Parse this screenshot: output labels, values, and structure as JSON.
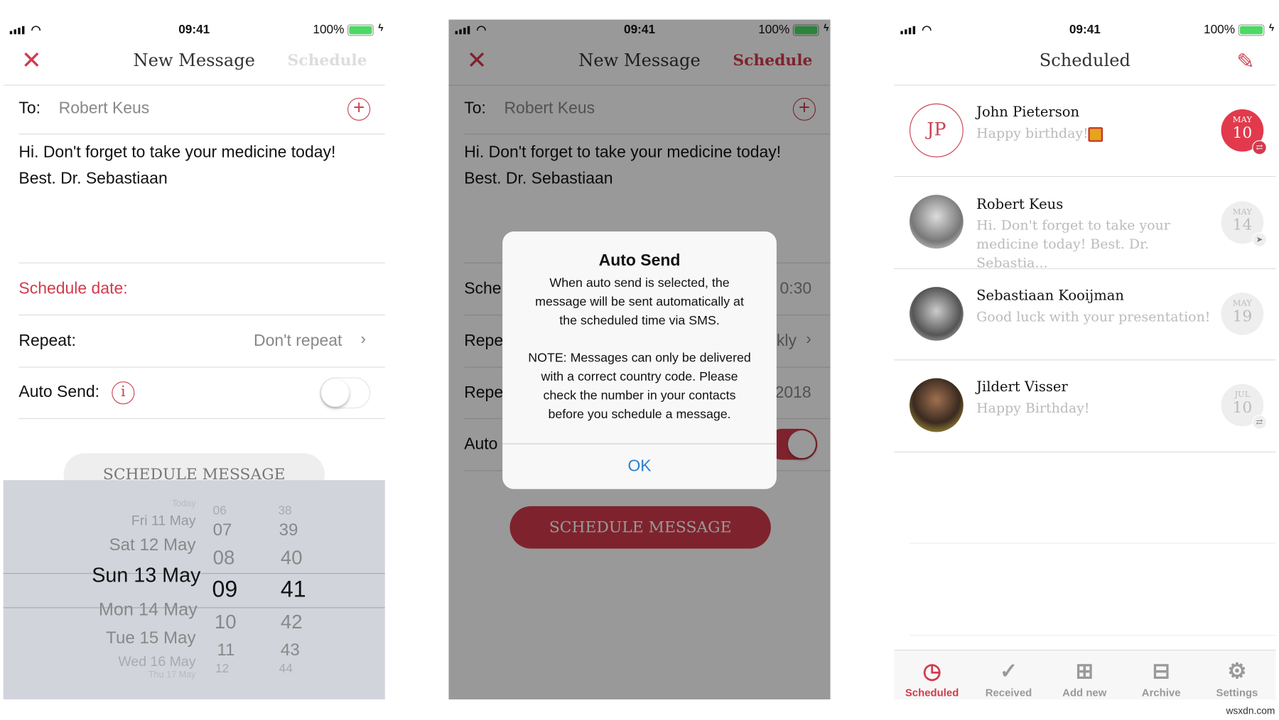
{
  "status": {
    "time": "09:41",
    "battery": "100%"
  },
  "colors": {
    "accent": "#d23b4c",
    "badge": "#e23a4c",
    "ok": "#2d7fd0"
  },
  "compose": {
    "title": "New Message",
    "close_icon": "close-icon",
    "schedule": "Schedule",
    "to_label": "To:",
    "to_value": "Robert Keus",
    "body_line1": "Hi. Don't forget to take your medicine today!",
    "body_line2": "Best. Dr. Sebastiaan",
    "schedule_date_label": "Schedule date:",
    "repeat_label": "Repeat:",
    "repeat_value": "Don't repeat",
    "auto_send_label": "Auto Send:",
    "auto_send_on": false,
    "button": "SCHEDULE MESSAGE"
  },
  "picker": {
    "dates": [
      "Today",
      "Fri 11 May",
      "Sat 12 May",
      "Sun 13 May",
      "Mon 14 May",
      "Tue 15 May",
      "Wed 16 May",
      "Thu 17 May"
    ],
    "hours": [
      "06",
      "07",
      "08",
      "09",
      "10",
      "11",
      "12"
    ],
    "minutes": [
      "38",
      "39",
      "40",
      "41",
      "42",
      "43",
      "44"
    ],
    "selected": {
      "date": "Sun 13 May",
      "hour": "09",
      "minute": "41"
    }
  },
  "compose2": {
    "title": "New Message",
    "schedule": "Schedule",
    "to_label": "To:",
    "to_value": "Robert Keus",
    "body_line1": "Hi. Don't forget to take your medicine today!",
    "body_line2": "Best. Dr. Sebastiaan",
    "row1_label": "Sche",
    "row1_value": "0:30",
    "row2_label": "Repe",
    "row2_value": "kly",
    "row3_label": "Repe",
    "row3_value": "2018",
    "row4_label": "Auto",
    "auto_send_on": true,
    "button": "SCHEDULE MESSAGE"
  },
  "dialog": {
    "title": "Auto Send",
    "line1": "When auto send is selected, the",
    "line2": "message will be sent automatically at",
    "line3": "the scheduled time via SMS.",
    "line4": "NOTE: Messages can only be delivered",
    "line5": "with a correct country code. Please",
    "line6": "check the number in your contacts",
    "line7": "before you schedule a message.",
    "ok": "OK"
  },
  "scheduled": {
    "title": "Scheduled",
    "items": [
      {
        "name": "John Pieterson",
        "initials": "JP",
        "message": "Happy birthday!",
        "month": "MAY",
        "day": "10",
        "icon": "repeat-icon",
        "active": true
      },
      {
        "name": "Robert Keus",
        "message": "Hi. Don't forget to take your medicine today! Best. Dr. Sebastia...",
        "month": "MAY",
        "day": "14",
        "icon": "send-icon",
        "active": false
      },
      {
        "name": "Sebastiaan Kooijman",
        "message": "Good luck with your presentation!",
        "month": "MAY",
        "day": "19",
        "icon": "",
        "active": false
      },
      {
        "name": "Jildert Visser",
        "message": "Happy Birthday!",
        "month": "JUL",
        "day": "10",
        "icon": "repeat-icon",
        "active": false
      }
    ]
  },
  "tabs": [
    {
      "label": "Scheduled",
      "icon": "clock-bubble-icon",
      "active": true
    },
    {
      "label": "Received",
      "icon": "check-bubble-icon"
    },
    {
      "label": "Add new",
      "icon": "plus-square-icon"
    },
    {
      "label": "Archive",
      "icon": "archive-box-icon"
    },
    {
      "label": "Settings",
      "icon": "gear-icon"
    }
  ],
  "watermark": "wsxdn.com"
}
